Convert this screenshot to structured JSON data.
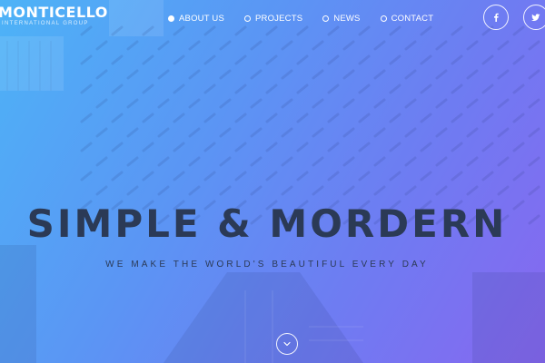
{
  "brand": {
    "logo": "MONTICELLO",
    "tagline": "INTERNATIONAL GROUP"
  },
  "nav": {
    "items": [
      {
        "label": "ABOUT US",
        "active": true
      },
      {
        "label": "PROJECTS",
        "active": false
      },
      {
        "label": "NEWS",
        "active": false
      },
      {
        "label": "CONTACT",
        "active": false
      }
    ]
  },
  "social": {
    "facebook_icon": "facebook-icon",
    "twitter_icon": "twitter-icon"
  },
  "hero": {
    "headline": "SIMPLE & MORDERN",
    "subline": "WE MAKE THE WORLD'S BEAUTIFUL EVERY DAY",
    "scroll_icon": "chevron-down-icon"
  },
  "colors": {
    "gradient_start": "#4db3f7",
    "gradient_end": "#8767f0",
    "headline": "#2b3a56",
    "nav_text": "#ffffff"
  }
}
